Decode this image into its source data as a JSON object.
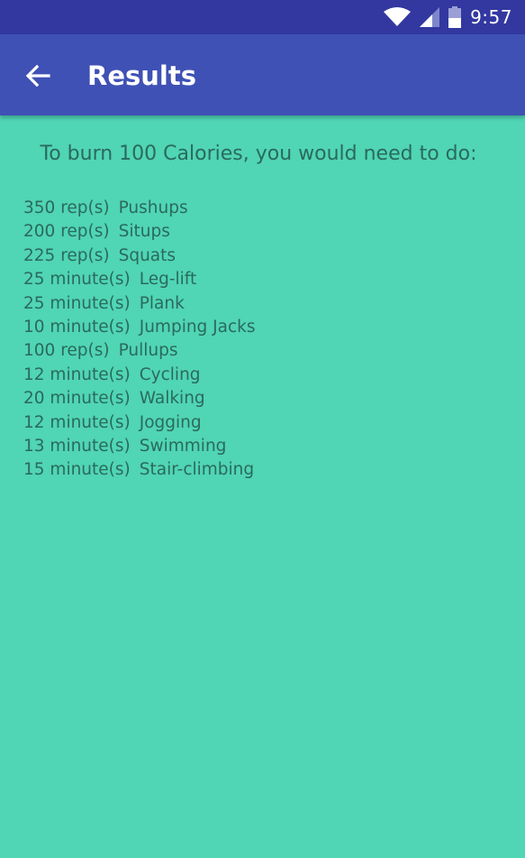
{
  "status_bar": {
    "time": "9:57",
    "icons": [
      "wifi-icon",
      "cell-signal-icon",
      "battery-icon"
    ],
    "background": "#3238a0"
  },
  "app_bar": {
    "title": "Results",
    "back_icon": "arrow-back-icon",
    "background": "#3f51b5"
  },
  "content": {
    "background": "#50d5b5",
    "text_color": "#2a6a5c",
    "headline": "To burn 100 Calories, you would need to do:",
    "exercises": [
      {
        "amount": "350 rep(s)",
        "name": "Pushups"
      },
      {
        "amount": "200 rep(s)",
        "name": "Situps"
      },
      {
        "amount": "225 rep(s)",
        "name": "Squats"
      },
      {
        "amount": "25 minute(s)",
        "name": "Leg-lift"
      },
      {
        "amount": "25 minute(s)",
        "name": "Plank"
      },
      {
        "amount": "10 minute(s)",
        "name": "Jumping Jacks"
      },
      {
        "amount": "100 rep(s)",
        "name": "Pullups"
      },
      {
        "amount": "12 minute(s)",
        "name": "Cycling"
      },
      {
        "amount": "20 minute(s)",
        "name": "Walking"
      },
      {
        "amount": "12 minute(s)",
        "name": "Jogging"
      },
      {
        "amount": "13 minute(s)",
        "name": "Swimming"
      },
      {
        "amount": "15 minute(s)",
        "name": "Stair-climbing"
      }
    ]
  }
}
